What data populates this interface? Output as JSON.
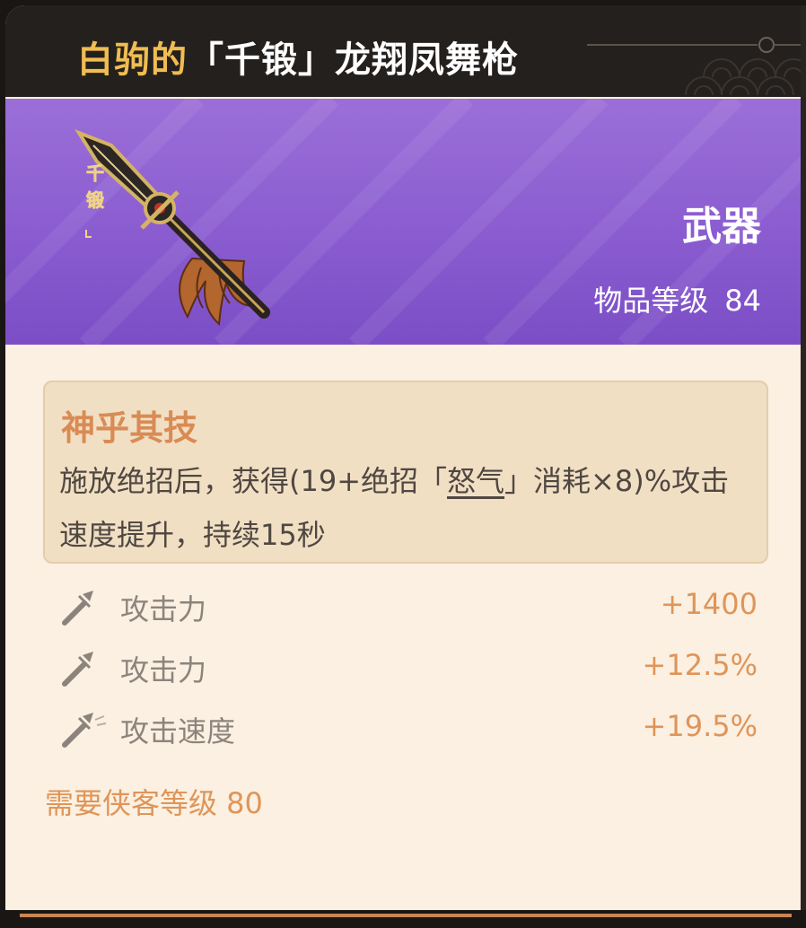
{
  "item": {
    "title_owner": "白驹的",
    "title_name": "「千锻」龙翔凤舞枪",
    "type": "武器",
    "level_label": "物品等级",
    "level_value": "84",
    "art_glyphs": [
      "千",
      "锻"
    ]
  },
  "skill": {
    "name": "神乎其技",
    "desc_part1": "施放绝招后，获得(19+绝招「",
    "desc_keyword": "怒气",
    "desc_part2": "」消耗×8)%攻击速度提升，持续15秒"
  },
  "stats": [
    {
      "label": "攻击力",
      "value": "+1400",
      "icon": "spear-icon"
    },
    {
      "label": "攻击力",
      "value": "+12.5%",
      "icon": "spear-icon"
    },
    {
      "label": "攻击速度",
      "value": "+19.5%",
      "icon": "fast-spear-icon"
    }
  ],
  "requirement": {
    "text": "需要侠客等级 80"
  },
  "colors": {
    "title_bar": "#24201d",
    "owner_gold": "#f0bd52",
    "rarity_purple": "#8a5cd0",
    "card_bg": "#fbf0e1",
    "accent_orange": "#df9559",
    "skill_name": "#d98b55"
  }
}
